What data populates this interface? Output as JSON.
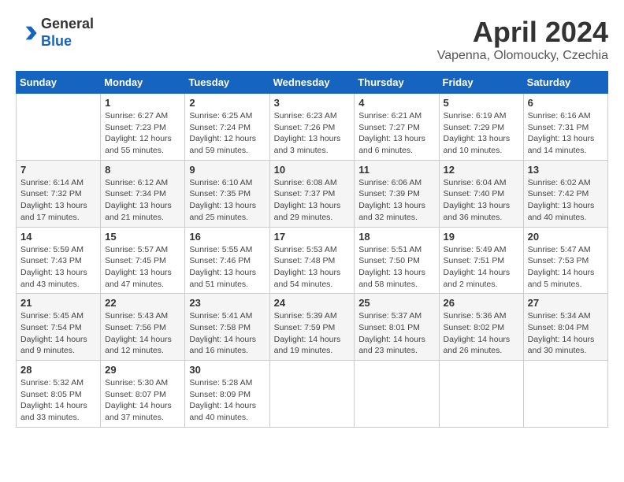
{
  "header": {
    "logo_line1": "General",
    "logo_line2": "Blue",
    "title": "April 2024",
    "subtitle": "Vapenna, Olomoucky, Czechia"
  },
  "weekdays": [
    "Sunday",
    "Monday",
    "Tuesday",
    "Wednesday",
    "Thursday",
    "Friday",
    "Saturday"
  ],
  "weeks": [
    [
      {
        "day": "",
        "sunrise": "",
        "sunset": "",
        "daylight": ""
      },
      {
        "day": "1",
        "sunrise": "Sunrise: 6:27 AM",
        "sunset": "Sunset: 7:23 PM",
        "daylight": "Daylight: 12 hours and 55 minutes."
      },
      {
        "day": "2",
        "sunrise": "Sunrise: 6:25 AM",
        "sunset": "Sunset: 7:24 PM",
        "daylight": "Daylight: 12 hours and 59 minutes."
      },
      {
        "day": "3",
        "sunrise": "Sunrise: 6:23 AM",
        "sunset": "Sunset: 7:26 PM",
        "daylight": "Daylight: 13 hours and 3 minutes."
      },
      {
        "day": "4",
        "sunrise": "Sunrise: 6:21 AM",
        "sunset": "Sunset: 7:27 PM",
        "daylight": "Daylight: 13 hours and 6 minutes."
      },
      {
        "day": "5",
        "sunrise": "Sunrise: 6:19 AM",
        "sunset": "Sunset: 7:29 PM",
        "daylight": "Daylight: 13 hours and 10 minutes."
      },
      {
        "day": "6",
        "sunrise": "Sunrise: 6:16 AM",
        "sunset": "Sunset: 7:31 PM",
        "daylight": "Daylight: 13 hours and 14 minutes."
      }
    ],
    [
      {
        "day": "7",
        "sunrise": "Sunrise: 6:14 AM",
        "sunset": "Sunset: 7:32 PM",
        "daylight": "Daylight: 13 hours and 17 minutes."
      },
      {
        "day": "8",
        "sunrise": "Sunrise: 6:12 AM",
        "sunset": "Sunset: 7:34 PM",
        "daylight": "Daylight: 13 hours and 21 minutes."
      },
      {
        "day": "9",
        "sunrise": "Sunrise: 6:10 AM",
        "sunset": "Sunset: 7:35 PM",
        "daylight": "Daylight: 13 hours and 25 minutes."
      },
      {
        "day": "10",
        "sunrise": "Sunrise: 6:08 AM",
        "sunset": "Sunset: 7:37 PM",
        "daylight": "Daylight: 13 hours and 29 minutes."
      },
      {
        "day": "11",
        "sunrise": "Sunrise: 6:06 AM",
        "sunset": "Sunset: 7:39 PM",
        "daylight": "Daylight: 13 hours and 32 minutes."
      },
      {
        "day": "12",
        "sunrise": "Sunrise: 6:04 AM",
        "sunset": "Sunset: 7:40 PM",
        "daylight": "Daylight: 13 hours and 36 minutes."
      },
      {
        "day": "13",
        "sunrise": "Sunrise: 6:02 AM",
        "sunset": "Sunset: 7:42 PM",
        "daylight": "Daylight: 13 hours and 40 minutes."
      }
    ],
    [
      {
        "day": "14",
        "sunrise": "Sunrise: 5:59 AM",
        "sunset": "Sunset: 7:43 PM",
        "daylight": "Daylight: 13 hours and 43 minutes."
      },
      {
        "day": "15",
        "sunrise": "Sunrise: 5:57 AM",
        "sunset": "Sunset: 7:45 PM",
        "daylight": "Daylight: 13 hours and 47 minutes."
      },
      {
        "day": "16",
        "sunrise": "Sunrise: 5:55 AM",
        "sunset": "Sunset: 7:46 PM",
        "daylight": "Daylight: 13 hours and 51 minutes."
      },
      {
        "day": "17",
        "sunrise": "Sunrise: 5:53 AM",
        "sunset": "Sunset: 7:48 PM",
        "daylight": "Daylight: 13 hours and 54 minutes."
      },
      {
        "day": "18",
        "sunrise": "Sunrise: 5:51 AM",
        "sunset": "Sunset: 7:50 PM",
        "daylight": "Daylight: 13 hours and 58 minutes."
      },
      {
        "day": "19",
        "sunrise": "Sunrise: 5:49 AM",
        "sunset": "Sunset: 7:51 PM",
        "daylight": "Daylight: 14 hours and 2 minutes."
      },
      {
        "day": "20",
        "sunrise": "Sunrise: 5:47 AM",
        "sunset": "Sunset: 7:53 PM",
        "daylight": "Daylight: 14 hours and 5 minutes."
      }
    ],
    [
      {
        "day": "21",
        "sunrise": "Sunrise: 5:45 AM",
        "sunset": "Sunset: 7:54 PM",
        "daylight": "Daylight: 14 hours and 9 minutes."
      },
      {
        "day": "22",
        "sunrise": "Sunrise: 5:43 AM",
        "sunset": "Sunset: 7:56 PM",
        "daylight": "Daylight: 14 hours and 12 minutes."
      },
      {
        "day": "23",
        "sunrise": "Sunrise: 5:41 AM",
        "sunset": "Sunset: 7:58 PM",
        "daylight": "Daylight: 14 hours and 16 minutes."
      },
      {
        "day": "24",
        "sunrise": "Sunrise: 5:39 AM",
        "sunset": "Sunset: 7:59 PM",
        "daylight": "Daylight: 14 hours and 19 minutes."
      },
      {
        "day": "25",
        "sunrise": "Sunrise: 5:37 AM",
        "sunset": "Sunset: 8:01 PM",
        "daylight": "Daylight: 14 hours and 23 minutes."
      },
      {
        "day": "26",
        "sunrise": "Sunrise: 5:36 AM",
        "sunset": "Sunset: 8:02 PM",
        "daylight": "Daylight: 14 hours and 26 minutes."
      },
      {
        "day": "27",
        "sunrise": "Sunrise: 5:34 AM",
        "sunset": "Sunset: 8:04 PM",
        "daylight": "Daylight: 14 hours and 30 minutes."
      }
    ],
    [
      {
        "day": "28",
        "sunrise": "Sunrise: 5:32 AM",
        "sunset": "Sunset: 8:05 PM",
        "daylight": "Daylight: 14 hours and 33 minutes."
      },
      {
        "day": "29",
        "sunrise": "Sunrise: 5:30 AM",
        "sunset": "Sunset: 8:07 PM",
        "daylight": "Daylight: 14 hours and 37 minutes."
      },
      {
        "day": "30",
        "sunrise": "Sunrise: 5:28 AM",
        "sunset": "Sunset: 8:09 PM",
        "daylight": "Daylight: 14 hours and 40 minutes."
      },
      {
        "day": "",
        "sunrise": "",
        "sunset": "",
        "daylight": ""
      },
      {
        "day": "",
        "sunrise": "",
        "sunset": "",
        "daylight": ""
      },
      {
        "day": "",
        "sunrise": "",
        "sunset": "",
        "daylight": ""
      },
      {
        "day": "",
        "sunrise": "",
        "sunset": "",
        "daylight": ""
      }
    ]
  ]
}
